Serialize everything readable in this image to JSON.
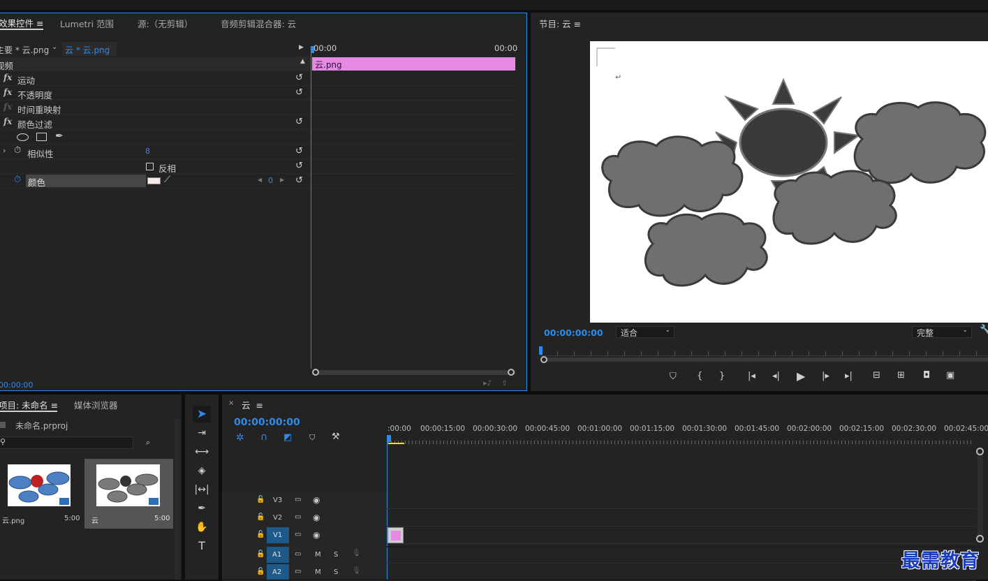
{
  "effect_controls": {
    "tabs": [
      "效果控件",
      "Lumetri 范围",
      "源:（无剪辑）",
      "音频剪辑混合器: 云"
    ],
    "master_label": "主要 * 云.png",
    "clip_label": "云 * 云.png",
    "time_start": "00:00",
    "time_end": "00:00",
    "clip_bar": "云.png",
    "section": "视频",
    "effects": [
      "运动",
      "不透明度",
      "时间重映射",
      "颜色过滤"
    ],
    "similarity_label": "相似性",
    "similarity_value": "8",
    "invert_label": "反相",
    "color_label": "颜色",
    "keyframe_value": "0",
    "timecode": "00:00:00"
  },
  "program": {
    "title": "节目: 云",
    "timecode": "00:00:00:00",
    "fit": "适合",
    "quality": "完整"
  },
  "project": {
    "tabs": [
      "项目: 未命名",
      "媒体浏览器"
    ],
    "file": "未命名.prproj",
    "items": [
      {
        "name": "云.png",
        "duration": "5:00"
      },
      {
        "name": "云",
        "duration": "5:00"
      }
    ]
  },
  "timeline": {
    "name": "云",
    "timecode": "00:00:00:00",
    "ruler": [
      ":00:00",
      "00:00:15:00",
      "00:00:30:00",
      "00:00:45:00",
      "00:01:00:00",
      "00:01:15:00",
      "00:01:30:00",
      "00:01:45:00",
      "00:02:00:00",
      "00:02:15:00",
      "00:02:30:00",
      "00:02:45:00"
    ],
    "tracks": [
      "V3",
      "V2",
      "V1",
      "A1",
      "A2"
    ],
    "audio_m": "M",
    "audio_s": "S"
  },
  "watermark": "最需教育",
  "colors": {
    "accent": "#2d8ceb",
    "clip": "#e589e5",
    "panel": "#232323"
  }
}
